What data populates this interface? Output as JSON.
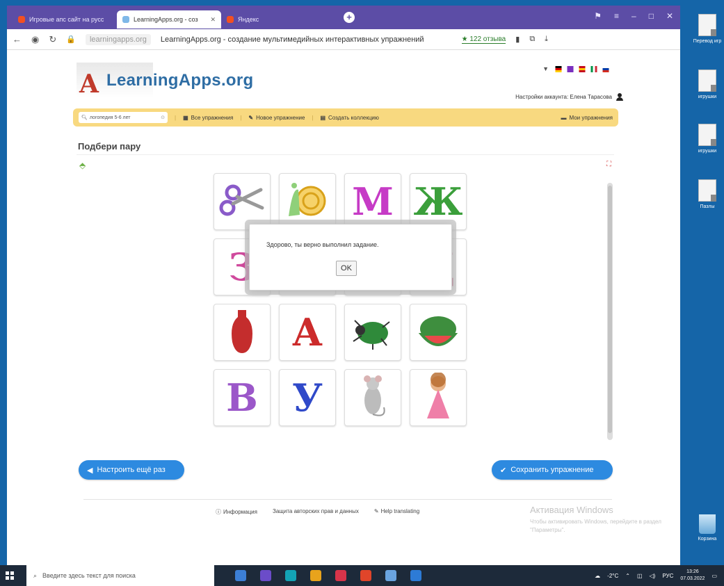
{
  "browser": {
    "tabs": [
      {
        "label": "Игровые апс сайт на русс"
      },
      {
        "label": "LearningApps.org - соз"
      },
      {
        "label": "Яндекс"
      }
    ],
    "address_domain": "learningapps.org",
    "address_title": "LearningApps.org - создание мультимедийных интерактивных упражнений",
    "reviews": "★ 122 отзыва"
  },
  "site": {
    "logo_text": "LearningApps.org",
    "logo_letter": "A",
    "account_label": "Настройки аккаунта: Елена Тарасова",
    "search_value": "логопедия 5-6 лет",
    "menu": {
      "all": "Все упражнения",
      "new": "Новое упражнение",
      "collection": "Создать коллекцию",
      "mine": "Мои упражнения"
    },
    "flag_colors": [
      "#000000",
      "#dd0000",
      "#ffce00",
      "#7a2fbf",
      "#c60b1e",
      "#ffc400",
      "#009246",
      "#ce2b37",
      "#ffffff",
      "#0039a6",
      "#d52b1e"
    ]
  },
  "exercise": {
    "title": "Подбери пару",
    "cards": [
      {
        "type": "scissors"
      },
      {
        "type": "snail"
      },
      {
        "type": "letter",
        "text": "М",
        "color": "#c63bc6"
      },
      {
        "type": "letter",
        "text": "Ж",
        "color": "#3b9f3b"
      },
      {
        "type": "letter",
        "text": "З",
        "color": "#d04a9d"
      },
      {
        "type": "blank"
      },
      {
        "type": "blank"
      },
      {
        "type": "letter",
        "text": "Д",
        "color": "#c63b6b"
      },
      {
        "type": "vase"
      },
      {
        "type": "letter",
        "text": "А",
        "color": "#cc2b2b"
      },
      {
        "type": "beetle"
      },
      {
        "type": "watermelon"
      },
      {
        "type": "letter",
        "text": "В",
        "color": "#9b57c9"
      },
      {
        "type": "letter",
        "text": "У",
        "color": "#2f49c9"
      },
      {
        "type": "mouse"
      },
      {
        "type": "doll"
      }
    ]
  },
  "dialog": {
    "message": "Здорово, ты верно выполнил задание.",
    "ok_label": "OK"
  },
  "buttons": {
    "retry": "Настроить ещё раз",
    "save": "Сохранить упражнение"
  },
  "footer": {
    "info": "Информация",
    "copyright": "Защита авторских прав и данных",
    "help": "Help translating"
  },
  "activation": {
    "title": "Активация Windows",
    "text": "Чтобы активировать Windows, перейдите в раздел \"Параметры\"."
  },
  "desktop_icons": [
    {
      "label": "Перевод игр"
    },
    {
      "label": "игрушки"
    },
    {
      "label": "игрушки"
    },
    {
      "label": "Пазлы"
    },
    {
      "label": "Корзина"
    }
  ],
  "taskbar": {
    "search_placeholder": "Введите здесь текст для поиска",
    "temperature": "-2°C",
    "lang": "РУС",
    "time": "13:26",
    "date": "07.03.2022",
    "app_colors": [
      "#3c7fd6",
      "#6b4cc9",
      "#13a3b5",
      "#e8a31c",
      "#d8344a",
      "#e0452a",
      "#6aa4e0",
      "#2d7bd6"
    ]
  }
}
